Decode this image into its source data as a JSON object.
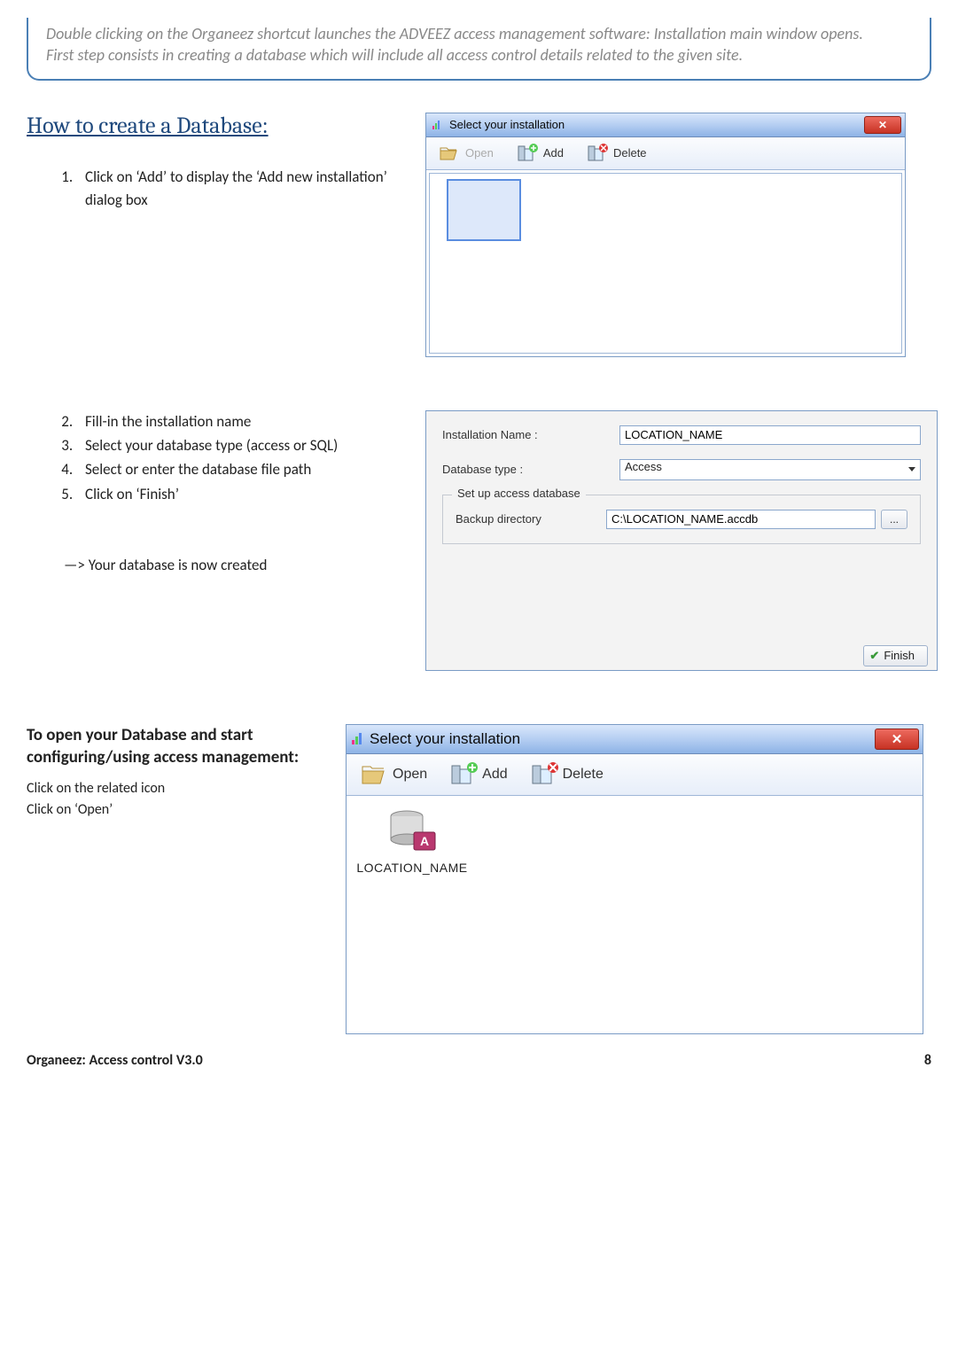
{
  "intro": {
    "p1": "Double clicking on the Organeez shortcut launches the ADVEEZ access management software: Installation main window opens.",
    "p2": "First step consists in creating a database which will include all access control details related to the given site."
  },
  "heading": "How to create a Database:",
  "steps_a": {
    "s1": "Click on ‘Add’ to display the ‘Add new installation’ dialog box"
  },
  "steps_b": {
    "s2": "Fill-in the installation name",
    "s3": "Select your database type (access or SQL)",
    "s4": "Select or enter the database file path",
    "s5": "Click on ‘Finish’"
  },
  "result_text": "—> Your database is now created",
  "open_section": {
    "heading": "To open your Database and start configuring/using access management:",
    "l1": "Click on the related icon",
    "l2": "Click on ‘Open’"
  },
  "dialog1": {
    "title": "Select your installation",
    "toolbar": {
      "open": "Open",
      "add": "Add",
      "delete": "Delete"
    }
  },
  "dialog2": {
    "label_name": "Installation Name :",
    "value_name": "LOCATION_NAME",
    "label_type": "Database type :",
    "value_type": "Access",
    "fieldset": "Set up access database",
    "label_backup": "Backup directory",
    "value_backup": "C:\\LOCATION_NAME.accdb",
    "browse": "...",
    "finish": "Finish"
  },
  "dialog3": {
    "title": "Select your installation",
    "toolbar": {
      "open": "Open",
      "add": "Add",
      "delete": "Delete"
    },
    "item_label": "LOCATION_NAME"
  },
  "footer": {
    "left": "Organeez: Access control    V3.0",
    "page": "8"
  }
}
